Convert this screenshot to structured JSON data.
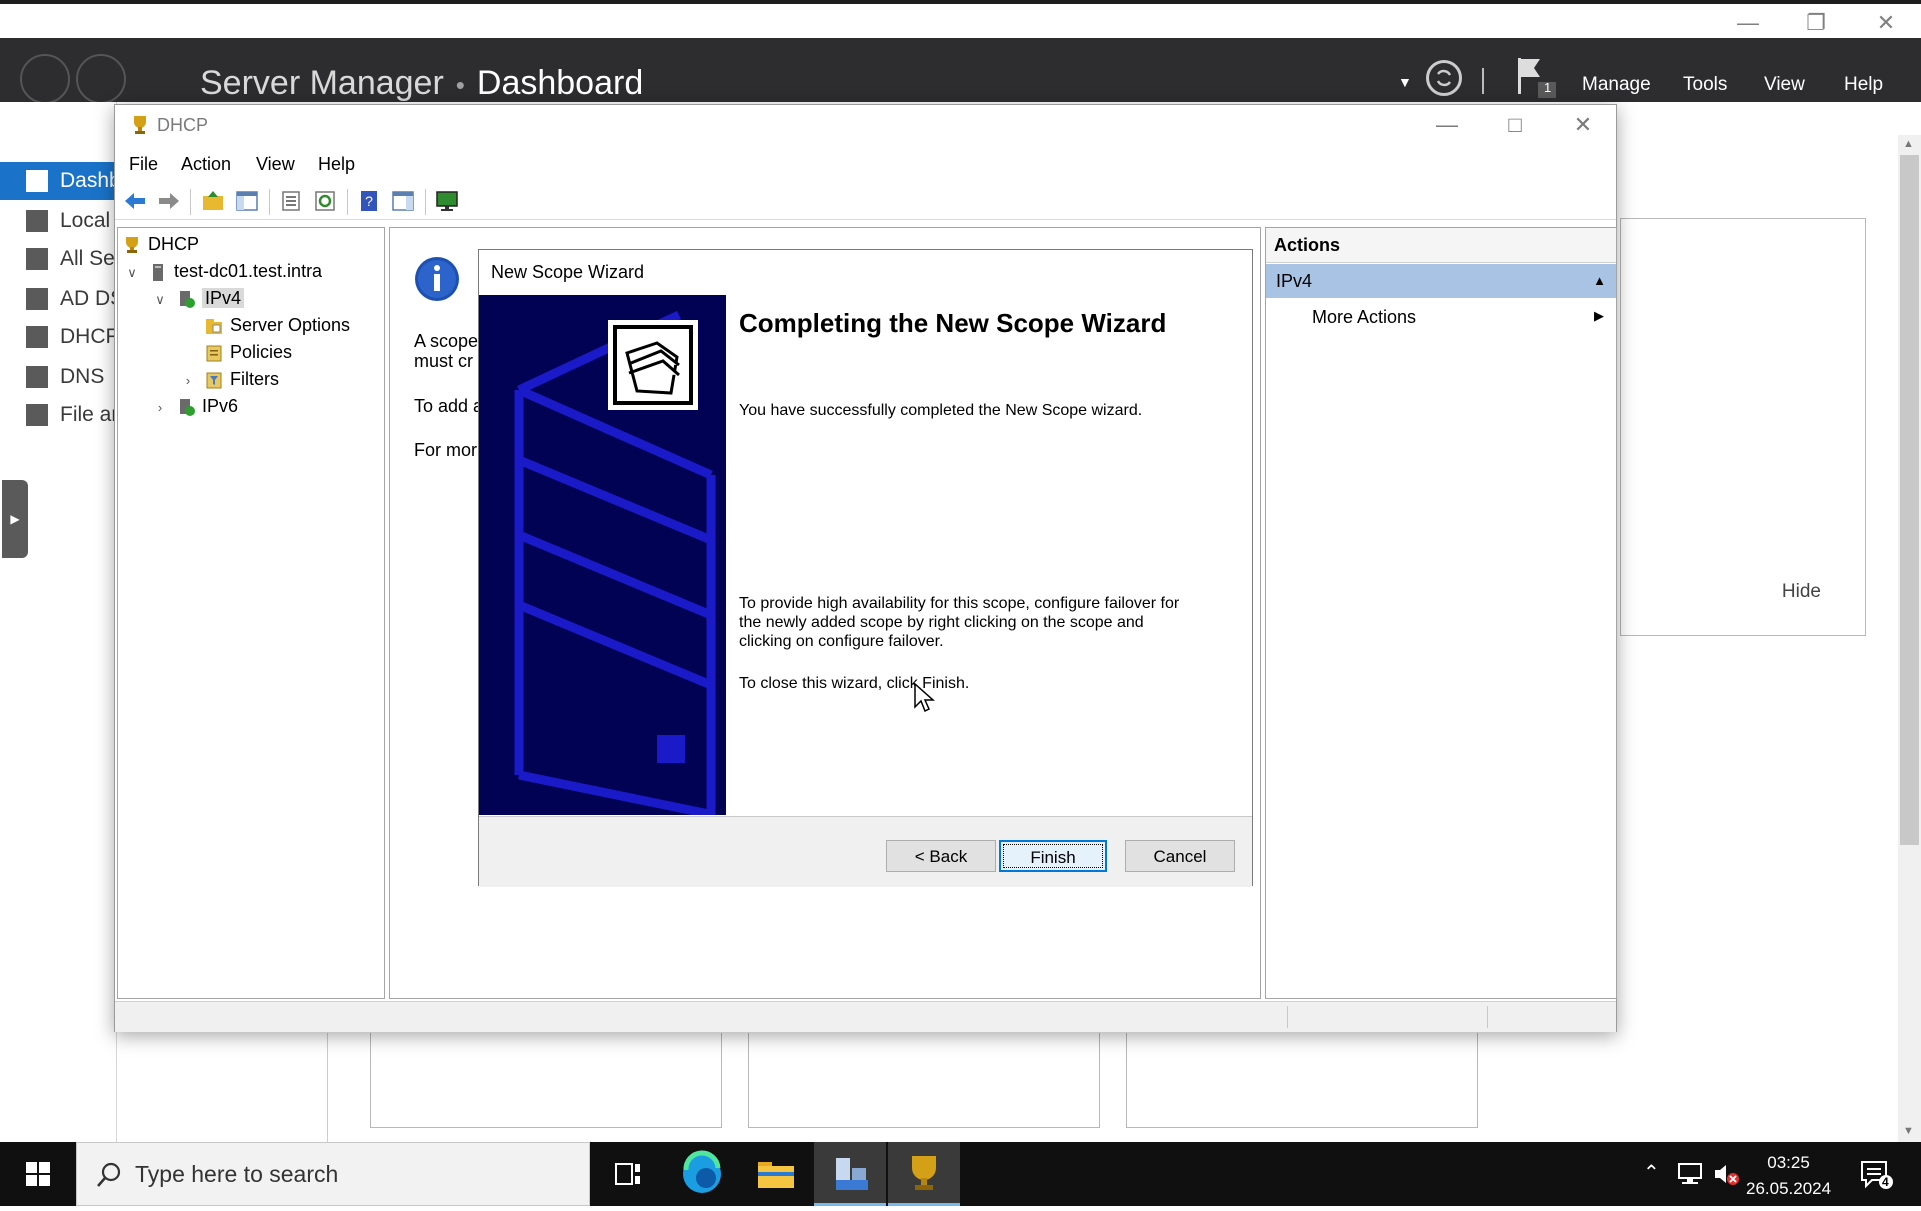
{
  "server_manager": {
    "breadcrumb": {
      "app": "Server Manager",
      "separator": "•",
      "page": "Dashboard"
    },
    "menu": [
      "Manage",
      "Tools",
      "View",
      "Help"
    ],
    "notification_count": "1",
    "nav": [
      {
        "label": "Dashboard",
        "active": true
      },
      {
        "label": "Local Server",
        "active": false
      },
      {
        "label": "All Servers",
        "active": false
      },
      {
        "label": "AD DS",
        "active": false
      },
      {
        "label": "DHCP",
        "active": false
      },
      {
        "label": "DNS",
        "active": false
      },
      {
        "label": "File and Storage Services",
        "active": false
      }
    ],
    "hide_label": "Hide"
  },
  "dhcp": {
    "title": "DHCP",
    "menu": {
      "file": "File",
      "action": "Action",
      "view": "View",
      "help": "Help"
    },
    "tree": {
      "root": "DHCP",
      "server": "test-dc01.test.intra",
      "ipv4": "IPv4",
      "server_options": "Server Options",
      "policies": "Policies",
      "filters": "Filters",
      "ipv6": "IPv6"
    },
    "center_text": {
      "line1": "A scope",
      "line2": "must cr",
      "line3": "To add a",
      "line4": "For mor"
    },
    "actions": {
      "header": "Actions",
      "selected": "IPv4",
      "more": "More Actions"
    }
  },
  "wizard": {
    "title": "New Scope Wizard",
    "heading": "Completing the New Scope Wizard",
    "success_text": "You have successfully completed the New Scope wizard.",
    "failover_text": "To provide high availability for this scope, configure failover for the newly added scope by right clicking on the scope and clicking on configure failover.",
    "close_text": "To close this wizard, click Finish.",
    "buttons": {
      "back": "< Back",
      "finish": "Finish",
      "cancel": "Cancel"
    }
  },
  "taskbar": {
    "search_placeholder": "Type here to search",
    "time": "03:25",
    "date": "26.05.2024",
    "notification_count": "4"
  }
}
